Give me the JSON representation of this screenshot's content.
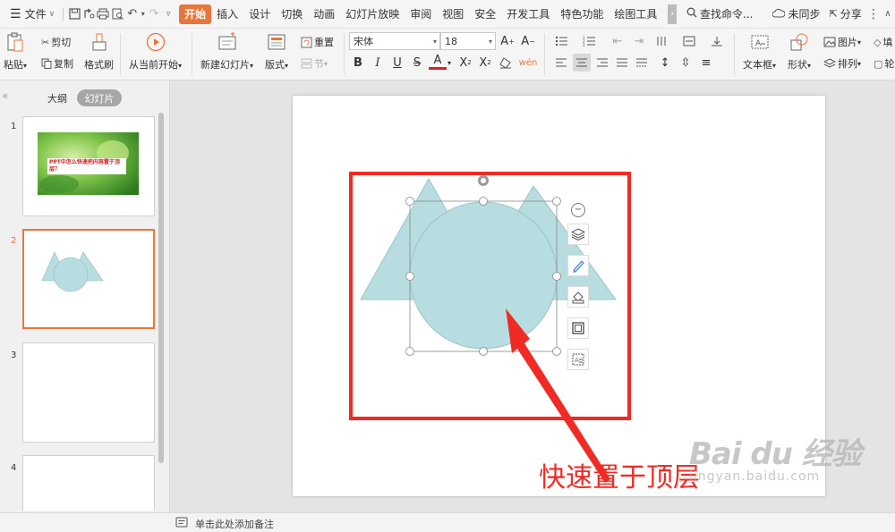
{
  "menubar": {
    "menu_label": "文件",
    "tabs": [
      {
        "label": "开始",
        "active": true
      },
      {
        "label": "插入"
      },
      {
        "label": "设计"
      },
      {
        "label": "切换"
      },
      {
        "label": "动画"
      },
      {
        "label": "幻灯片放映"
      },
      {
        "label": "审阅"
      },
      {
        "label": "视图"
      },
      {
        "label": "安全"
      },
      {
        "label": "开发工具"
      },
      {
        "label": "特色功能"
      },
      {
        "label": "绘图工具"
      }
    ],
    "search_label": "查找命令...",
    "sync_label": "未同步",
    "share_label": "分享"
  },
  "ribbon": {
    "paste": "粘贴",
    "cut": "剪切",
    "copy": "复制",
    "format_painter": "格式刷",
    "from_current": "从当前开始",
    "new_slide": "新建幻灯片",
    "layout": "版式",
    "reset": "重置",
    "section": "节",
    "font_name": "宋体",
    "font_size": "18",
    "textbox": "文本框",
    "shape": "形状",
    "picture": "图片",
    "arrange": "排列",
    "fill_partial": "填",
    "outline_partial": "轮"
  },
  "leftpanel": {
    "tab_outline": "大纲",
    "tab_slides": "幻灯片",
    "slides": [
      {
        "num": "1",
        "caption": "PPT中怎么快速把内容置于顶层？"
      },
      {
        "num": "2",
        "current": true
      },
      {
        "num": "3"
      },
      {
        "num": "4"
      }
    ]
  },
  "statusbar": {
    "notes_placeholder": "单击此处添加备注"
  },
  "annotation": {
    "text": "快速置于顶层",
    "color": "#f02a24"
  },
  "watermark": {
    "logo": "Bai du 经验",
    "url": "jingyan.baidu.com"
  },
  "colors": {
    "accent": "#e8753a",
    "shape_fill": "#b8dde1",
    "annotation_red": "#f02a24"
  }
}
